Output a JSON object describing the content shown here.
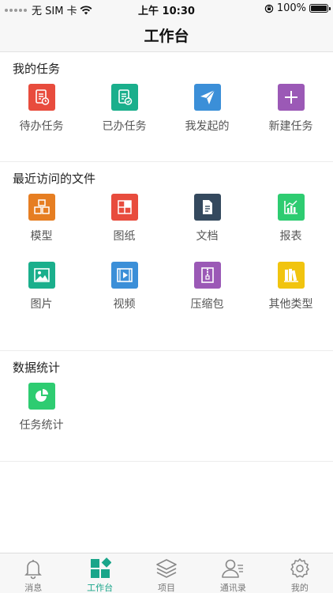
{
  "status_bar": {
    "carrier": "无 SIM 卡",
    "time": "上午 10:30",
    "battery": "100%"
  },
  "nav": {
    "title": "工作台"
  },
  "my_tasks": {
    "title": "我的任务",
    "items": [
      {
        "label": "待办任务",
        "icon": "todo-task-icon",
        "color": "#e84c3d"
      },
      {
        "label": "已办任务",
        "icon": "done-task-icon",
        "color": "#1aaf8c"
      },
      {
        "label": "我发起的",
        "icon": "paper-plane-icon",
        "color": "#3b8fd8"
      },
      {
        "label": "新建任务",
        "icon": "plus-icon",
        "color": "#9b59b6"
      }
    ]
  },
  "recent_files": {
    "title": "最近访问的文件",
    "items": [
      {
        "label": "模型",
        "icon": "cubes-icon",
        "color": "#e67e22"
      },
      {
        "label": "图纸",
        "icon": "drawing-icon",
        "color": "#e84c3d"
      },
      {
        "label": "文档",
        "icon": "document-icon",
        "color": "#34495e"
      },
      {
        "label": "报表",
        "icon": "bar-chart-icon",
        "color": "#2ecc71"
      },
      {
        "label": "图片",
        "icon": "image-icon",
        "color": "#1aaf8c"
      },
      {
        "label": "视频",
        "icon": "video-icon",
        "color": "#3b8fd8"
      },
      {
        "label": "压缩包",
        "icon": "archive-icon",
        "color": "#9b59b6"
      },
      {
        "label": "其他类型",
        "icon": "books-icon",
        "color": "#f1c40f"
      }
    ]
  },
  "stats": {
    "title": "数据统计",
    "items": [
      {
        "label": "任务统计",
        "icon": "pie-chart-icon",
        "color": "#2ecc71"
      }
    ]
  },
  "tab_bar": {
    "tabs": [
      {
        "label": "消息",
        "icon": "bell-icon",
        "active": false
      },
      {
        "label": "工作台",
        "icon": "dashboard-icon",
        "active": true
      },
      {
        "label": "项目",
        "icon": "layers-icon",
        "active": false
      },
      {
        "label": "通讯录",
        "icon": "contacts-icon",
        "active": false
      },
      {
        "label": "我的",
        "icon": "settings-icon",
        "active": false
      }
    ],
    "active_color": "#1aa58a",
    "inactive_color": "#777777"
  }
}
